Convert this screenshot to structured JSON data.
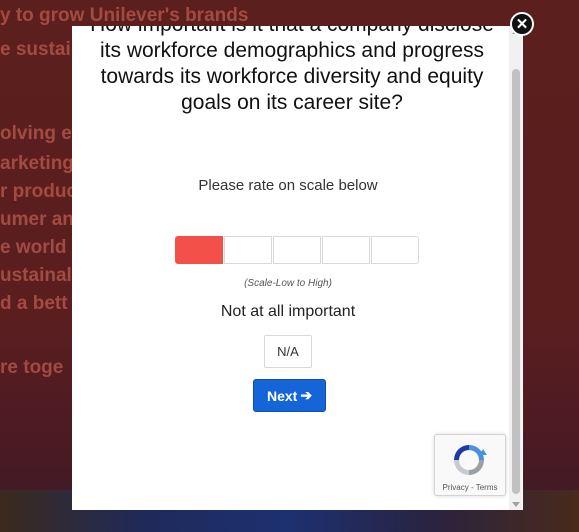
{
  "background": {
    "lines": [
      "y to grow Unilever's brands",
      "e sustaina",
      "olving eve",
      "arketing",
      "r produc",
      "umer an",
      "e world",
      "ustainal",
      "d a bett",
      "re toge"
    ]
  },
  "modal": {
    "question": "How important is it that a company disclose its workforce demographics and progress towards its workforce diversity and equity goals on its career site?",
    "subtitle": "Please rate on scale below",
    "scale_hint": "(Scale-Low to High)",
    "selected_rating": 1,
    "scale_max": 5,
    "rating_label": "Not at all important",
    "na_label": "N/A",
    "next_label": "Next",
    "next_icon": "arrow-right-icon",
    "recaptcha_links": "Privacy - Terms"
  },
  "colors": {
    "accent": "#1565d8",
    "selected": "#f3504a"
  },
  "close_icon": "close-icon"
}
